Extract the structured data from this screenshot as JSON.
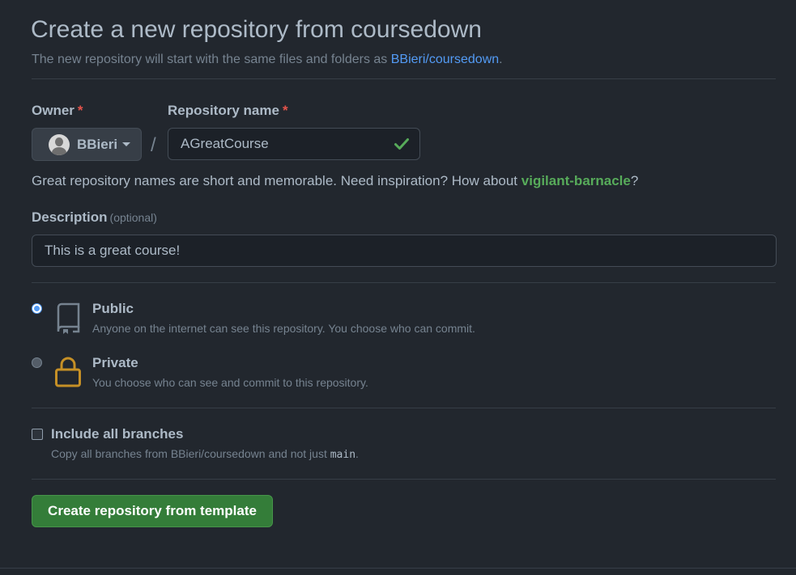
{
  "header": {
    "title": "Create a new repository from coursedown",
    "subtitle_prefix": "The new repository will start with the same files and folders as",
    "template_link": "BBieri/coursedown",
    "subtitle_suffix": "."
  },
  "owner": {
    "label": "Owner",
    "required_mark": "*",
    "value": "BBieri",
    "icon": "avatar"
  },
  "separator": "/",
  "repo_name": {
    "label": "Repository name",
    "required_mark": "*",
    "value": "AGreatCourse",
    "status_icon": "check-icon",
    "status_color": "#57ab5a"
  },
  "name_hint": {
    "prefix": "Great repository names are short and memorable. Need inspiration? How about",
    "suggestion": "vigilant-barnacle",
    "suffix": "?"
  },
  "description": {
    "label": "Description",
    "optional": "(optional)",
    "value": "This is a great course!"
  },
  "visibility": {
    "selected": "public",
    "options": [
      {
        "id": "public",
        "title": "Public",
        "desc": "Anyone on the internet can see this repository. You choose who can commit.",
        "icon": "repo-icon"
      },
      {
        "id": "private",
        "title": "Private",
        "desc": "You choose who can see and commit to this repository.",
        "icon": "lock-icon"
      }
    ]
  },
  "branches": {
    "checked": false,
    "label": "Include all branches",
    "desc_prefix": "Copy all branches from BBieri/coursedown and not just",
    "desc_code": "main",
    "desc_suffix": "."
  },
  "submit_label": "Create repository from template",
  "colors": {
    "background": "#22272e",
    "link": "#539bf5",
    "success": "#57ab5a",
    "required": "#e5534b",
    "primary_button": "#347d39",
    "lock": "#c69026"
  }
}
